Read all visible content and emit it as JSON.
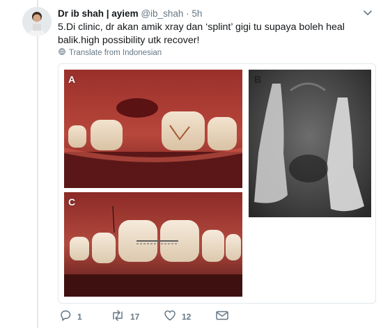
{
  "tweet": {
    "author_name": "Dr ib shah | ayiem",
    "handle": "@ib_shah",
    "separator": "·",
    "time": "5h",
    "text": "5.Di clinic, dr akan amik xray dan ‘splint’ gigi tu supaya boleh heal balik.high possibility utk recover!",
    "translate_label": "Translate from Indonesian"
  },
  "media": {
    "panels": [
      {
        "label": "A"
      },
      {
        "label": "B"
      },
      {
        "label": "C"
      }
    ]
  },
  "actions": {
    "reply_count": "1",
    "retweet_count": "17",
    "like_count": "12"
  },
  "icons": {
    "caret": "chevron-down-icon",
    "globe": "globe-icon",
    "reply": "reply-icon",
    "retweet": "retweet-icon",
    "like": "heart-icon",
    "dm": "envelope-icon"
  },
  "colors": {
    "secondary_text": "#657786",
    "border": "#e1e8ed"
  }
}
